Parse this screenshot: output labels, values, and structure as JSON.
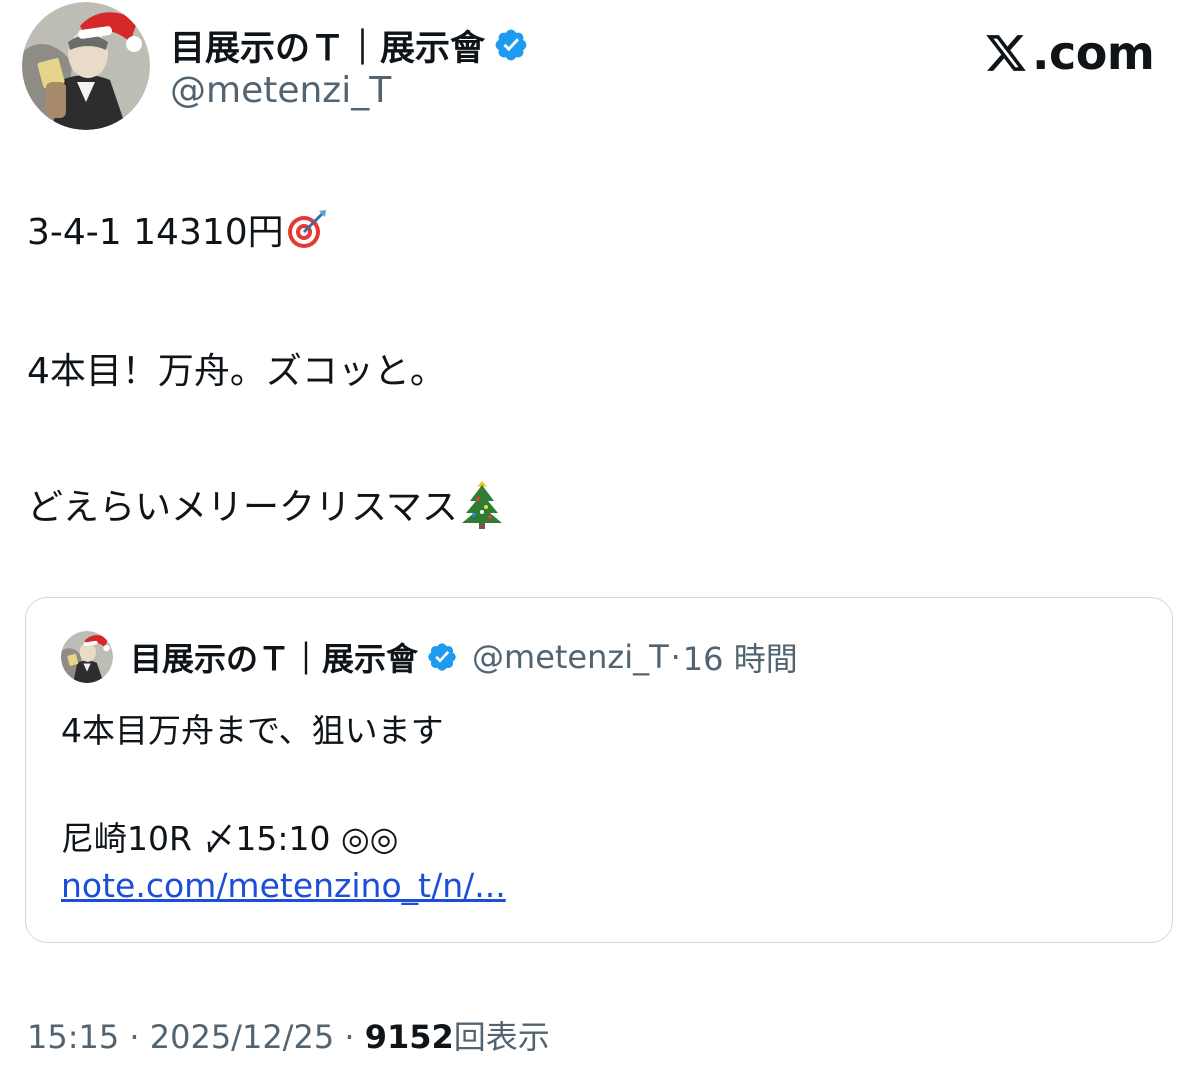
{
  "author": {
    "name": "目展示のＴ｜展示會",
    "handle": "@metenzi_T",
    "verified": true
  },
  "brand": {
    "label": ".com"
  },
  "tweet": {
    "lines": [
      "3-4-1  14310円",
      "4本目！万舟。ズコッと。",
      "どえらいメリークリスマス"
    ],
    "emojis": [
      "direct-hit-dart-emoji",
      "christmas-tree-emoji"
    ]
  },
  "quote": {
    "name": "目展示のＴ｜展示會",
    "handle": "@metenzi_T",
    "separator": "·",
    "time": "16 時間",
    "lines": [
      "4本目万舟まで、狙います",
      "尼崎10R  〆15:10 ◎◎"
    ],
    "link": "note.com/metenzino_t/n/..."
  },
  "meta": {
    "time": "15:15",
    "separator": "·",
    "date": "2025/12/25",
    "views_count": "9152",
    "views_label": "回表示"
  },
  "colors": {
    "text": "#0f1419",
    "secondary": "#536471",
    "verified": "#1d9bf0",
    "link": "#1d4ed8",
    "border": "#cfd9de"
  }
}
